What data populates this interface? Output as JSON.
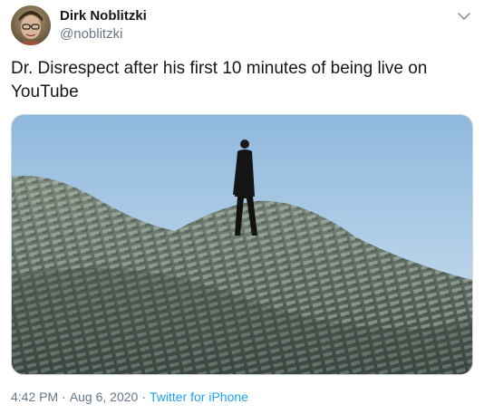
{
  "user": {
    "display_name": "Dirk Noblitzki",
    "handle": "@noblitzki"
  },
  "tweet": {
    "text": "Dr. Disrespect after his first 10 minutes of being live on YouTube"
  },
  "meta": {
    "time": "4:42 PM",
    "separator": "·",
    "date": "Aug 6, 2020",
    "source": "Twitter for iPhone"
  },
  "icons": {
    "caret": "chevron-down-icon"
  },
  "colors": {
    "text": "#14171a",
    "secondary": "#657786",
    "link": "#1da1f2",
    "border": "#ccd6dd"
  }
}
